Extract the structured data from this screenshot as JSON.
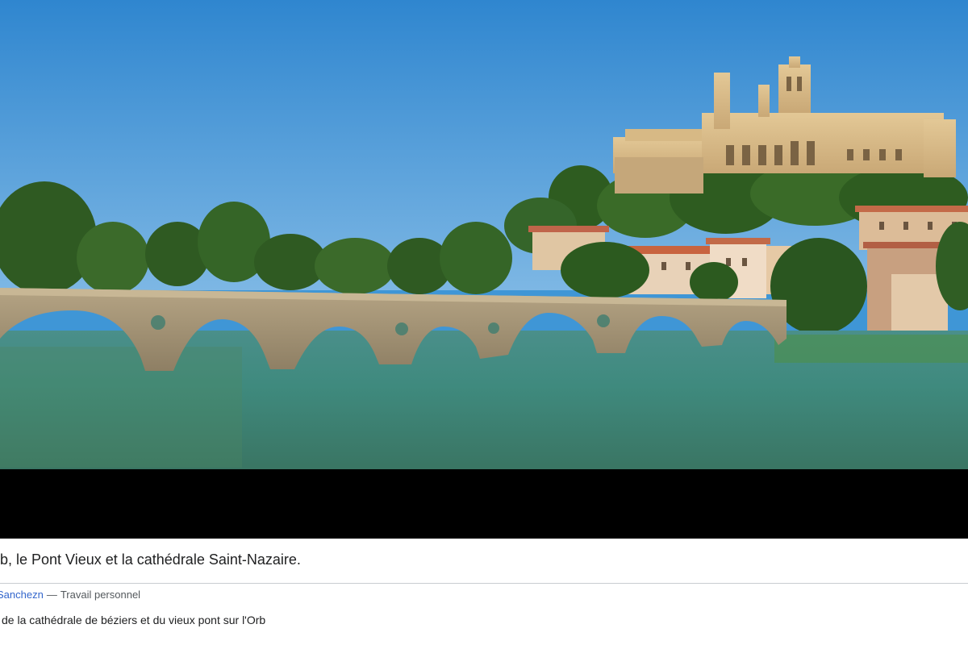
{
  "caption": {
    "title": "rb, le Pont Vieux et la cathédrale Saint-Nazaire.",
    "author": "Sanchezn",
    "separator": "—",
    "source": "Travail personnel",
    "description": "de la cathédrale de béziers et du vieux pont sur l'Orb"
  },
  "colors": {
    "sky": "#3f96d6",
    "water": "#3f8a7e",
    "stone": "#a39273",
    "letterbox": "#000000",
    "link": "#3366cc"
  }
}
